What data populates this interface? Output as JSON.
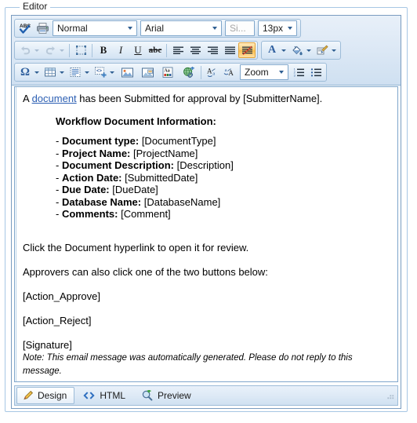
{
  "groupbox": {
    "title": "Editor"
  },
  "toolbar": {
    "row1": {
      "spellcheck_icon": "spellcheck-abc-icon",
      "print_icon": "print-icon",
      "style_value": "Normal",
      "font_value": "Arial",
      "size_value": "Si...",
      "size_px_value": "13px"
    },
    "row2": {
      "undo_icon": "undo-icon",
      "redo_icon": "redo-icon",
      "selectall_icon": "select-all-icon",
      "bold_label": "B",
      "italic_label": "I",
      "underline_label": "U",
      "strike_label": "abc",
      "align_left_icon": "align-left-icon",
      "align_center_icon": "align-center-icon",
      "align_right_icon": "align-right-icon",
      "align_justify_icon": "align-justify-icon",
      "remove_format_icon": "remove-format-icon",
      "font_color_label": "A",
      "fill_color_icon": "paint-bucket-icon",
      "format_painter_icon": "format-painter-icon"
    },
    "row3": {
      "symbol_label": "Ω",
      "table_icon": "insert-table-icon",
      "form_icon": "insert-form-icon",
      "snippet_icon": "insert-code-snippet-icon",
      "image_icon": "insert-image-icon",
      "image_map_icon": "image-map-editor-icon",
      "text_art_icon": "insert-text-art-icon",
      "hyperlink_icon": "insert-hyperlink-icon",
      "lowercase_icon": "to-lowercase-icon",
      "uppercase_icon": "to-uppercase-icon",
      "zoom_value": "Zoom",
      "numbered_list_icon": "numbered-list-icon",
      "bulleted_list_icon": "bulleted-list-icon"
    }
  },
  "content": {
    "intro_before": "A ",
    "intro_link": "document",
    "intro_after": " has been Submitted for approval by [SubmitterName].",
    "section_heading": "Workflow Document Information:",
    "fields": [
      {
        "label": "Document type:",
        "value": "[DocumentType]"
      },
      {
        "label": "Project Name:",
        "value": "[ProjectName]"
      },
      {
        "label": "Document Description:",
        "value": "[Description]"
      },
      {
        "label": "Action Date:",
        "value": "[SubmittedDate]"
      },
      {
        "label": "Due Date:",
        "value": "[DueDate]"
      },
      {
        "label": "Database Name:",
        "value": "[DatabaseName]"
      },
      {
        "label": "Comments:",
        "value": "[Comment]"
      }
    ],
    "para_click": "Click the Document hyperlink to open it for review.",
    "para_approvers": "Approvers can also click one of the two buttons below:",
    "token_approve": "[Action_Approve]",
    "token_reject": "[Action_Reject]",
    "token_signature": "[Signature]",
    "note": "Note: This email message was automatically generated. Please do not reply to this message."
  },
  "tabs": [
    {
      "label": "Design",
      "icon": "pencil-icon",
      "selected": true
    },
    {
      "label": "HTML",
      "icon": "angle-brackets-icon",
      "selected": false
    },
    {
      "label": "Preview",
      "icon": "magnifier-plus-icon",
      "selected": false
    }
  ],
  "colors": {
    "toolbar_bg": "#dce8f5",
    "panel_border": "#7fa6cb",
    "link": "#2c5fb3",
    "active_button": "#fbbc48",
    "groupbox_border": "#a7c7e4"
  }
}
